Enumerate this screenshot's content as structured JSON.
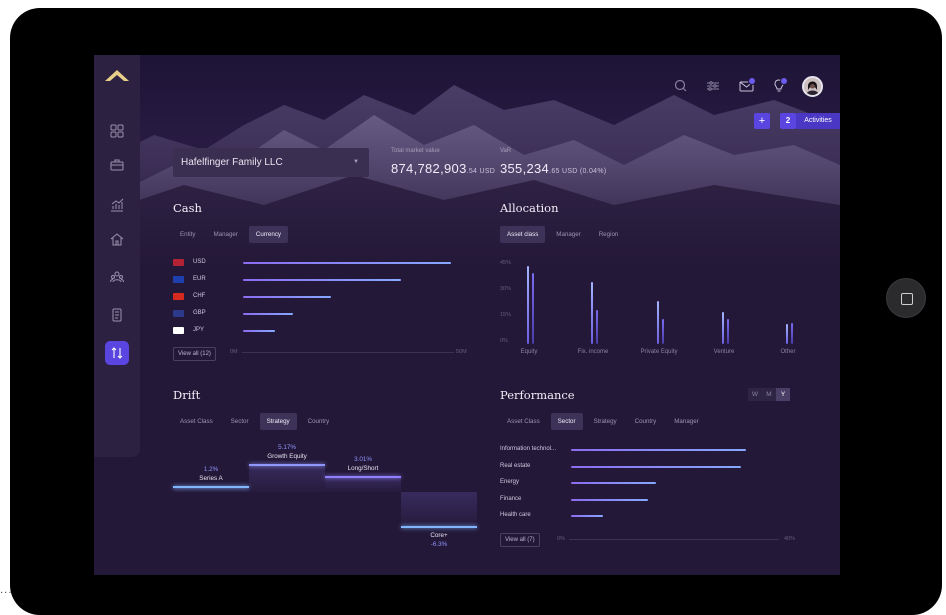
{
  "account": {
    "name": "Hafelfinger Family LLC"
  },
  "kpis": [
    {
      "label": "Total market value",
      "value_main": "874,782,903",
      "value_small": ".54 USD"
    },
    {
      "label": "VaR",
      "value_main": "355,234",
      "value_small": ".65 USD (0.04%)"
    }
  ],
  "header": {
    "plus": "+",
    "activities_count": "2",
    "activities_label": "Activities",
    "mail_badge": "",
    "bulb_badge": ""
  },
  "cash": {
    "title": "Cash",
    "tabs": [
      "Entity",
      "Manager",
      "Currency"
    ],
    "active_tab": "Currency",
    "rows": [
      {
        "currency": "USD",
        "flag_color": "#b22234",
        "value": 0.99
      },
      {
        "currency": "EUR",
        "flag_color": "#1e40af",
        "value": 0.75
      },
      {
        "currency": "CHF",
        "flag_color": "#d52b1e",
        "value": 0.42
      },
      {
        "currency": "GBP",
        "flag_color": "#2d3a8c",
        "value": 0.24
      },
      {
        "currency": "JPY",
        "flag_color": "#ffffff",
        "value": 0.15
      }
    ],
    "view_all": "View all (12)",
    "axis_min": "0M",
    "axis_max": "50M"
  },
  "allocation": {
    "title": "Allocation",
    "tabs": [
      "Asset class",
      "Manager",
      "Region"
    ],
    "active_tab": "Asset class",
    "y_ticks": [
      "45%",
      "30%",
      "15%",
      "0%"
    ],
    "categories": [
      "Equity",
      "Fix. income",
      "Private Equity",
      "Venture",
      "Other"
    ],
    "series_a": [
      44,
      35,
      24,
      18,
      11
    ],
    "series_b": [
      40,
      19,
      14,
      14,
      12
    ]
  },
  "drift": {
    "title": "Drift",
    "tabs": [
      "Asset Class",
      "Sector",
      "Strategy",
      "Country"
    ],
    "active_tab": "Strategy",
    "items": [
      {
        "name": "Series A",
        "value": "1.2%",
        "num": 1.2
      },
      {
        "name": "Growth Equity",
        "value": "5.17%",
        "num": 5.17
      },
      {
        "name": "Long/Short",
        "value": "3.01%",
        "num": 3.01
      },
      {
        "name": "Core+",
        "value": "-6.3%",
        "num": -6.3
      }
    ]
  },
  "performance": {
    "title": "Performance",
    "period_buttons": [
      "W",
      "M",
      "Y"
    ],
    "active_period": "Y",
    "tabs": [
      "Asset Class",
      "Sector",
      "Strategy",
      "Country",
      "Manager"
    ],
    "active_tab": "Sector",
    "rows": [
      {
        "label": "Information technol...",
        "value": 0.82
      },
      {
        "label": "Real estate",
        "value": 0.8
      },
      {
        "label": "Energy",
        "value": 0.4
      },
      {
        "label": "Finance",
        "value": 0.36
      },
      {
        "label": "Health care",
        "value": 0.15
      }
    ],
    "view_all": "View all (7)",
    "axis_min": "0%",
    "axis_max": "40%"
  },
  "colors": {
    "accent": "#5a45e0",
    "bar_light": "#86a8ff",
    "bar_purple": "#8b6df0",
    "background": "#241838"
  }
}
